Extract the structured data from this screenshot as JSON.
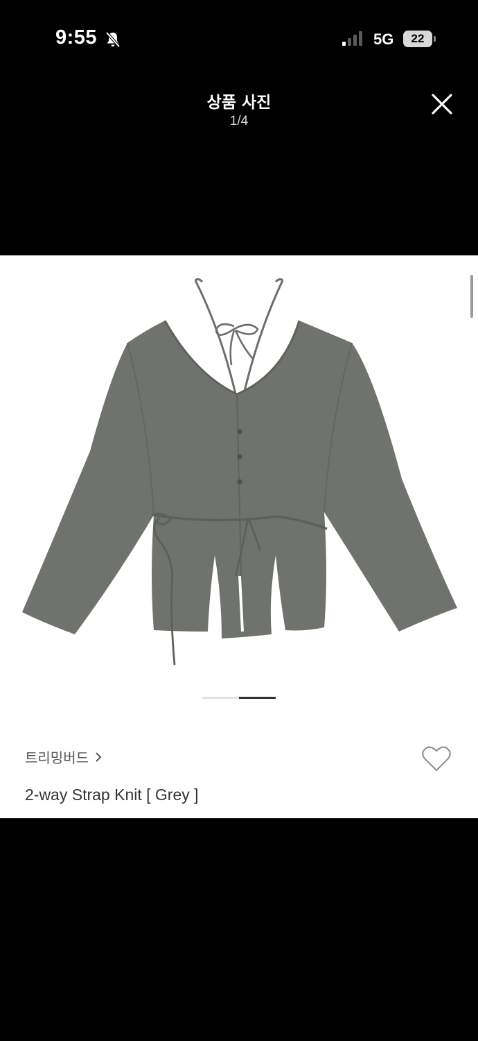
{
  "status_bar": {
    "time": "9:55",
    "network": "5G",
    "battery": "22",
    "icons": [
      "bell-slash-icon",
      "cellular-signal-icon",
      "battery-icon"
    ]
  },
  "header": {
    "title": "상품 사진",
    "counter": "1/4",
    "close_icon": "close-icon"
  },
  "product": {
    "image_description_icon": "cardigan-photo",
    "pager": {
      "count": 2,
      "active_index": 1
    },
    "brand": "트리밍버드",
    "brand_icon": "chevron-right-icon",
    "wishlist_icon": "heart-icon",
    "name": "2-way Strap Knit [ Grey ]"
  },
  "colors": {
    "background": "#000000",
    "card": "#ffffff",
    "garment": "#6f726d",
    "text_primary": "#333333",
    "text_secondary": "#555555"
  }
}
